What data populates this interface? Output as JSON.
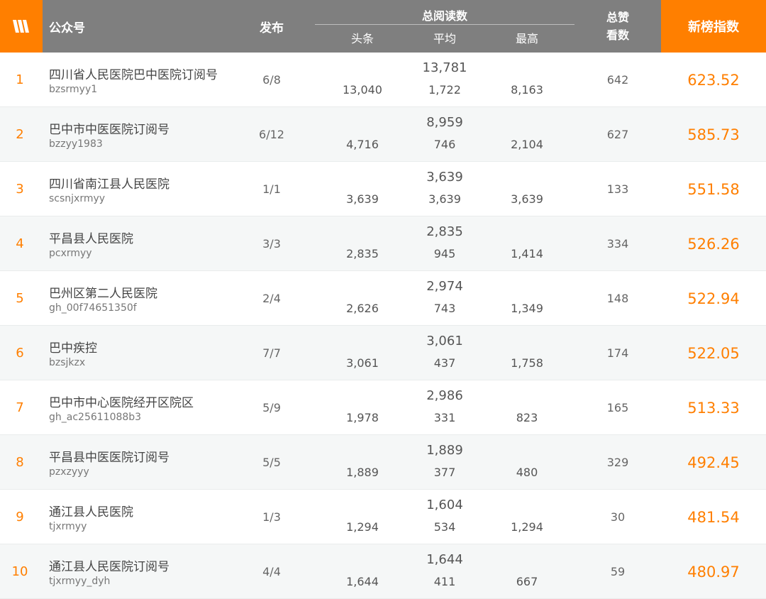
{
  "header": {
    "account": "公众号",
    "publish": "发布",
    "total_reads": "总阅读数",
    "headline": "头条",
    "average": "平均",
    "highest": "最高",
    "likes_line1": "总赞",
    "likes_line2": "看数",
    "index": "新榜指数",
    "accent_color": "#ff7f00",
    "header_bg": "#7f7f7f"
  },
  "rows": [
    {
      "rank": "1",
      "name": "四川省人民医院巴中医院订阅号",
      "id": "bzsrmyy1",
      "publish": "6/8",
      "total": "13,781",
      "headline": "13,040",
      "average": "1,722",
      "highest": "8,163",
      "likes": "642",
      "index": "623.52"
    },
    {
      "rank": "2",
      "name": "巴中市中医医院订阅号",
      "id": "bzzyy1983",
      "publish": "6/12",
      "total": "8,959",
      "headline": "4,716",
      "average": "746",
      "highest": "2,104",
      "likes": "627",
      "index": "585.73"
    },
    {
      "rank": "3",
      "name": "四川省南江县人民医院",
      "id": "scsnjxrmyy",
      "publish": "1/1",
      "total": "3,639",
      "headline": "3,639",
      "average": "3,639",
      "highest": "3,639",
      "likes": "133",
      "index": "551.58"
    },
    {
      "rank": "4",
      "name": "平昌县人民医院",
      "id": "pcxrmyy",
      "publish": "3/3",
      "total": "2,835",
      "headline": "2,835",
      "average": "945",
      "highest": "1,414",
      "likes": "334",
      "index": "526.26"
    },
    {
      "rank": "5",
      "name": "巴州区第二人民医院",
      "id": "gh_00f74651350f",
      "publish": "2/4",
      "total": "2,974",
      "headline": "2,626",
      "average": "743",
      "highest": "1,349",
      "likes": "148",
      "index": "522.94"
    },
    {
      "rank": "6",
      "name": "巴中疾控",
      "id": "bzsjkzx",
      "publish": "7/7",
      "total": "3,061",
      "headline": "3,061",
      "average": "437",
      "highest": "1,758",
      "likes": "174",
      "index": "522.05"
    },
    {
      "rank": "7",
      "name": "巴中市中心医院经开区院区",
      "id": "gh_ac25611088b3",
      "publish": "5/9",
      "total": "2,986",
      "headline": "1,978",
      "average": "331",
      "highest": "823",
      "likes": "165",
      "index": "513.33"
    },
    {
      "rank": "8",
      "name": "平昌县中医医院订阅号",
      "id": "pzxzyyy",
      "publish": "5/5",
      "total": "1,889",
      "headline": "1,889",
      "average": "377",
      "highest": "480",
      "likes": "329",
      "index": "492.45"
    },
    {
      "rank": "9",
      "name": "通江县人民医院",
      "id": "tjxrmyy",
      "publish": "1/3",
      "total": "1,604",
      "headline": "1,294",
      "average": "534",
      "highest": "1,294",
      "likes": "30",
      "index": "481.54"
    },
    {
      "rank": "10",
      "name": "通江县人民医院订阅号",
      "id": "tjxrmyy_dyh",
      "publish": "4/4",
      "total": "1,644",
      "headline": "1,644",
      "average": "411",
      "highest": "667",
      "likes": "59",
      "index": "480.97"
    }
  ]
}
